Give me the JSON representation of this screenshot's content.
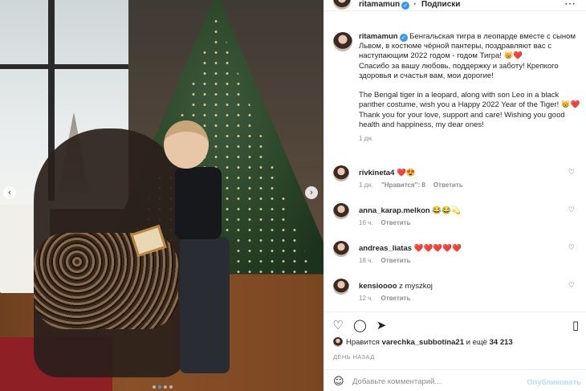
{
  "header": {
    "username": "ritamamun",
    "separator": "•",
    "follow_label": "Подписки",
    "more_icon": "more-dots-icon"
  },
  "caption": {
    "username": "ritamamun",
    "text": "Бенгальская тигра в леопарде вместе с сыном Львом, в костюме чёрной пантеры, поздравляют вас с наступающим 2022 годом - годом Тигра! 😸❤️\nСпасибо за вашу любовь, поддержку и заботу! Крепкого здоровья и счастья вам, мои дорогие!\n\nThe Bengal tiger in a leopard, along with son Leo in a black panther costume, wish you a Happy 2022 Year of the Tiger! 😸❤️\nThank you for your love, support and care! Wishing you good health and happiness, my dear ones!",
    "time": "1 дн."
  },
  "comments": [
    {
      "username": "rivkineta4",
      "text": "❤️😍",
      "time": "1 дн.",
      "likes": "\"Нравится\": 8",
      "reply": "Ответить"
    },
    {
      "username": "anna_karap.melkon",
      "text": "😂😂💫",
      "time": "16 ч.",
      "likes": "",
      "reply": "Ответить"
    },
    {
      "username": "andreas_liatas",
      "text": "❤️❤️❤️❤️❤️",
      "time": "18 ч.",
      "likes": "",
      "reply": "Ответить"
    },
    {
      "username": "kensioooo",
      "text": "z myszkoj",
      "time": "12 ч.",
      "likes": "",
      "reply": "Ответить"
    }
  ],
  "likes": {
    "prefix": "Нравится",
    "user": "varechka_subbotina21",
    "middle": "и ещё",
    "count": "34 213"
  },
  "posted_ago": "ДЕНЬ НАЗАД",
  "composer": {
    "placeholder": "Добавьте комментарий...",
    "post_label": "Опубликовать"
  },
  "photo": {
    "dots": 4,
    "active_dot": 1
  },
  "colors": {
    "verified": "#3897f0",
    "post_disabled": "#b2dffc",
    "muted": "#8e8e8e"
  }
}
